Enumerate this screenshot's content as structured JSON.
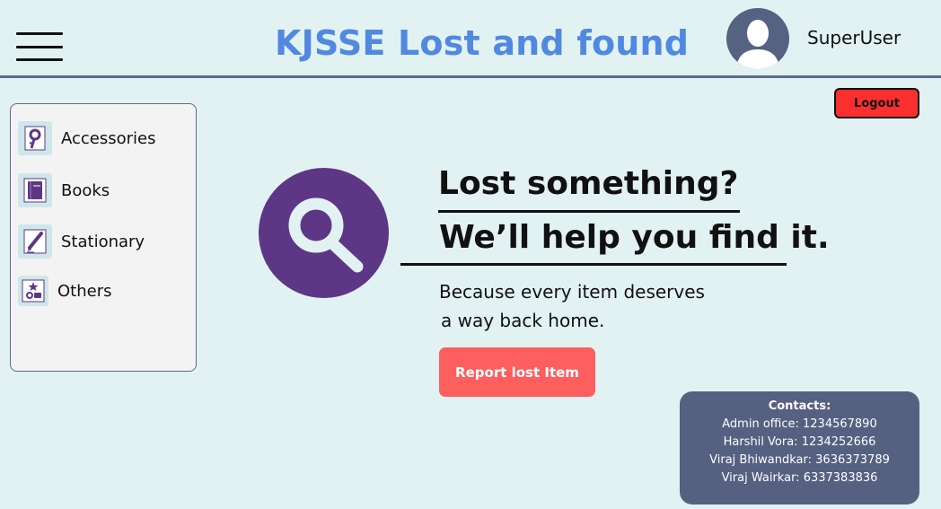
{
  "header": {
    "menu_icon": "hamburger-icon",
    "title": "KJSSE Lost and found",
    "title_color": "#5189e0",
    "avatar_icon": "user-avatar-icon",
    "username": "SuperUser"
  },
  "logout": {
    "label": "Logout",
    "color": "#fb2f2f"
  },
  "sidebar": {
    "items": [
      {
        "label": "Accessories",
        "icon": "key-icon"
      },
      {
        "label": "Books",
        "icon": "book-icon"
      },
      {
        "label": "Stationary",
        "icon": "pen-icon"
      },
      {
        "label": "Others",
        "icon": "misc-items-icon"
      }
    ]
  },
  "hero": {
    "icon": "search-icon",
    "accent_color": "#5d3786",
    "headline_1": "Lost something?",
    "headline_2": "We’ll help you find it.",
    "subtext_1": "Because every item deserves",
    "subtext_2": "a way back home.",
    "cta_label": "Report lost Item",
    "cta_color": "#fd5e5e"
  },
  "contacts": {
    "title": "Contacts:",
    "lines": [
      "Admin office: 1234567890",
      "Harshil Vora: 1234252666",
      "Viraj Bhiwandkar: 3636373789",
      "Viraj Wairkar: 6337383836"
    ],
    "bg_color": "#566080"
  }
}
